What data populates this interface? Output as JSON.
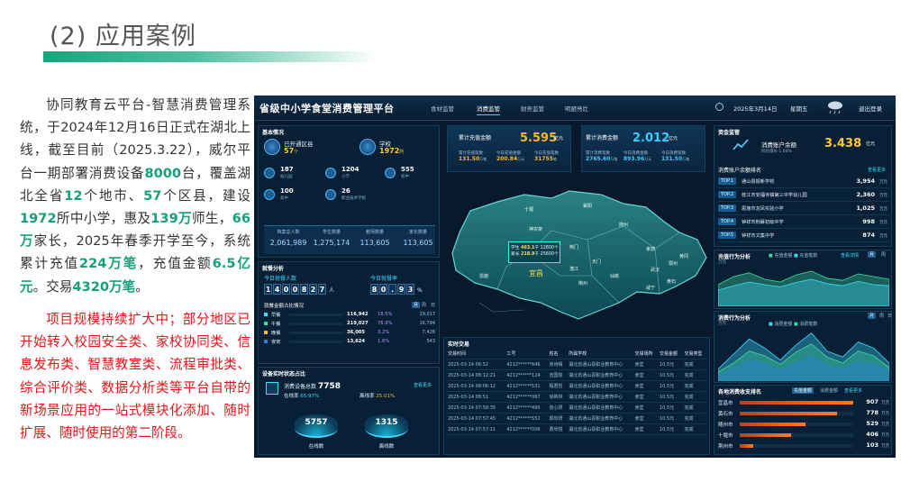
{
  "slide": {
    "title": "(2) 应用案例",
    "para1_parts": [
      "协同教育云平台-智慧消费管理系统，于2024年12月16日正式在湖北上线，截至目前（2025.3.22），威尔平台一期部署消费设备",
      "8000",
      "台，覆盖湖北全省",
      "12",
      "个地市、",
      "57",
      "个区县，建设",
      "1972",
      "所中小学，惠及",
      "139万",
      "师生，",
      "66万",
      "家长，2025年春季开学至今，系统累计充值",
      "224万笔",
      "，充值金额",
      "6.5亿元",
      "。交易",
      "4320万笔",
      "。"
    ],
    "para2": "项目规模持续扩大中；部分地区已开始转入校园安全类、家校协同类、信息发布类、智慧教室类、流程审批类、综合评价类、数据分析类等平台自带的新场景应用的一站式模块化添加、随时扩展、随时使用的第二阶段。"
  },
  "dashboard": {
    "title": "省级中小学食堂消费管理平台",
    "tabs": [
      "食材监管",
      "消费监管",
      "财务监管",
      "明厨亮灶"
    ],
    "active_tab": 1,
    "date": "2025年3月14日",
    "weekday": "星期五",
    "logout": "退出登录",
    "basic": {
      "header": "基本情况",
      "counties_label": "已开通区县",
      "counties_value": "57",
      "counties_unit": "个",
      "schools_label": "学校",
      "schools_value": "1972",
      "schools_unit": "所",
      "stats": [
        {
          "value": "187",
          "sub": "幼儿园"
        },
        {
          "value": "1204",
          "sub": "小学"
        },
        {
          "value": "555",
          "sub": "初中"
        },
        {
          "value": "100",
          "sub": "高中"
        },
        {
          "value": "26",
          "sub": "职业技术学校"
        }
      ],
      "totals_labels": [
        "档案总人数",
        "学生数量",
        "教师数量",
        "家长数量"
      ],
      "totals_values": [
        "2,061,989",
        "1,275,174",
        "113,605",
        "113,605"
      ]
    },
    "recharge": {
      "label": "累计充值金额",
      "value": "5.595",
      "unit": "亿元",
      "sub": [
        {
          "label": "累计充值笔数",
          "value": "131.50",
          "unit": "万笔"
        },
        {
          "label": "今日充值金额",
          "value": "200.84",
          "unit": "万元"
        },
        {
          "label": "今日充值笔数",
          "value": "31755",
          "unit": "笔"
        }
      ]
    },
    "consume": {
      "label": "累计消费金额",
      "value": "2.012",
      "unit": "亿元",
      "sub": [
        {
          "label": "累计消费笔数",
          "value": "2765.60",
          "unit": "万笔"
        },
        {
          "label": "今日消费金额",
          "value": "893.96",
          "unit": "万元"
        },
        {
          "label": "今日消费笔数",
          "value": "131.50",
          "unit": "万笔"
        }
      ]
    },
    "map": {
      "cities": [
        "十堰",
        "襄阳",
        "随州",
        "孝感",
        "黄冈",
        "武汉",
        "荆门",
        "宜昌",
        "恩施",
        "荆州",
        "咸宁",
        "黄石",
        "鄂州",
        "天门",
        "潜江",
        "仙桃",
        "神农架"
      ],
      "highlight": "宜昌",
      "popup": [
        {
          "label": "学生",
          "value": "463.1",
          "unit": "千",
          "extra": "12800",
          "extra_unit": "个"
        },
        {
          "label": "家长",
          "value": "218.9",
          "unit": "千",
          "extra": "25600",
          "extra_unit": "个"
        }
      ]
    },
    "funds": {
      "header": "资金监管",
      "balance_label": "消费账户余额",
      "balance_value": "3.438",
      "balance_unit": "亿元",
      "ratio": "同比增长 1.04%",
      "rank_header": "消费账户余额排名",
      "rank_more": "查看更多",
      "rank": [
        {
          "badge": "TOP.1",
          "name": "通山县振新学校",
          "value": "3,954",
          "unit": "万元"
        },
        {
          "badge": "TOP.2",
          "name": "枝江市安福寺镇第三中学幼儿园",
          "value": "2,360",
          "unit": "万元"
        },
        {
          "badge": "TOP.3",
          "name": "恩施市龙凤实验小学",
          "value": "1,025",
          "unit": "万元"
        },
        {
          "badge": "TOP.4",
          "name": "钟祥市荆襄初级中学",
          "value": "998",
          "unit": "万元"
        },
        {
          "badge": "TOP.5",
          "name": "钟祥市文集中学",
          "value": "874",
          "unit": "万元"
        }
      ]
    },
    "recharge_behavior": {
      "header": "充值行为分析",
      "legend": [
        "充值金额",
        "充值笔数"
      ],
      "detail": "查看详情",
      "period": [
        "月",
        "周"
      ],
      "unit": "万元",
      "series_a": [
        40,
        55,
        62,
        50,
        45,
        58,
        65,
        52,
        48,
        60,
        55,
        50
      ],
      "series_b": [
        30,
        38,
        45,
        40,
        36,
        44,
        50,
        42,
        38,
        46,
        40,
        38
      ]
    },
    "consume_behavior": {
      "header": "消费行为分析",
      "legend": [
        "消费金额",
        "消费笔数"
      ],
      "period": [
        "月",
        "周",
        "日"
      ],
      "unit": "万元",
      "series_a": [
        20,
        45,
        70,
        55,
        35,
        60,
        80,
        50,
        40,
        65,
        55,
        30
      ],
      "series_b": [
        15,
        30,
        50,
        42,
        28,
        48,
        62,
        40,
        30,
        50,
        42,
        22
      ],
      "series_c": [
        10,
        20,
        35,
        28,
        18,
        30,
        42,
        25,
        20,
        32,
        28,
        15
      ]
    },
    "city_rank": {
      "header": "各地消费收支排名",
      "btns": [
        "充值金额",
        "消费金额",
        "查看更多"
      ],
      "items": [
        {
          "name": "宜昌市",
          "value": "907",
          "unit": "万元",
          "pct": 1.0
        },
        {
          "name": "黄石市",
          "value": "778",
          "unit": "万元",
          "pct": 0.86
        },
        {
          "name": "随州市",
          "value": "529",
          "unit": "万元",
          "pct": 0.58
        },
        {
          "name": "十堰市",
          "value": "406",
          "unit": "万元",
          "pct": 0.45
        },
        {
          "name": "荆州市",
          "value": "103",
          "unit": "万元",
          "pct": 0.12
        }
      ]
    },
    "dining": {
      "header": "就餐分析",
      "today_label": "今日就餐人数",
      "today_digits": [
        "1",
        "4",
        "0",
        "0",
        "8",
        "2",
        "7"
      ],
      "today_unit": "人",
      "rate_label": "今日就餐率",
      "rate_digits": [
        "8",
        "0",
        ".",
        "9",
        "3"
      ],
      "rate_unit": "%",
      "split_header": "就餐金额占比情况",
      "split_period": [
        "月",
        "周",
        "日"
      ],
      "rows": [
        {
          "name": "早餐",
          "value": "116,942",
          "pct": "18.5%",
          "count": "29,017"
        },
        {
          "name": "午餐",
          "value": "219,027",
          "pct": "76.9%",
          "count": "16,794"
        },
        {
          "name": "晚餐",
          "value": "36,005",
          "pct": "3.2%",
          "count": "7,428"
        },
        {
          "name": "夜宵",
          "value": "13,624",
          "pct": "1.6%",
          "count": "543"
        }
      ]
    },
    "devices": {
      "header": "设备实时状态占比",
      "total_label": "消费设备总数",
      "total_value": "7758",
      "more": "查看更多",
      "online_label": "在线率",
      "online_value": "65.97%",
      "offline_label": "离线率",
      "offline_value": "25.01%",
      "online_count": "5757",
      "online_count_label": "在线数",
      "offline_count": "1315",
      "offline_count_label": "离线数"
    },
    "tx": {
      "header": "实时交易",
      "cols": [
        "交易时间",
        "工号",
        "姓名",
        "所属学校",
        "交易场所",
        "交易金额",
        "交易类型"
      ],
      "rows": [
        [
          "2025-03-14 06:52",
          "4212******646",
          "张诗晴",
          "湖北省通山县职业教育中心",
          "食堂",
          "10.5元",
          "完成"
        ],
        [
          "2025-03-14 08:12:21",
          "4212******124",
          "宣国俊",
          "湖北省通山县职业教育中心",
          "食堂",
          "10.5元",
          "完成"
        ],
        [
          "2025-03-14 08:06:12",
          "4212******531",
          "程君哲",
          "湖北省通山县职业教育中心",
          "食堂",
          "10.5元",
          "完成"
        ],
        [
          "2025-03-14 08:51",
          "4212******067",
          "徐新林",
          "湖北省通山县职业教育中心",
          "食堂",
          "10.5元",
          "完成"
        ],
        [
          "2025-03-14 07:58:35",
          "4212******495",
          "张心妍",
          "湖北省通山县职业教育中心",
          "食堂",
          "10.5元",
          "完成"
        ],
        [
          "2025-03-14 07:57:45",
          "4212******552",
          "郭欣妍",
          "湖北省通山县职业教育中心",
          "食堂",
          "10.5元",
          "完成"
        ],
        [
          "2025-03-14 07:57:11",
          "4212******006",
          "曹欣悦",
          "湖北省通山县职业教育中心",
          "食堂",
          "10.5元",
          "完成"
        ]
      ]
    },
    "colors": {
      "bg": "#07192b",
      "cyan": "#3fdcff",
      "yellow": "#ffc933",
      "green": "#1ec98f",
      "accent": "#15a07a",
      "red": "#e4141b"
    }
  }
}
